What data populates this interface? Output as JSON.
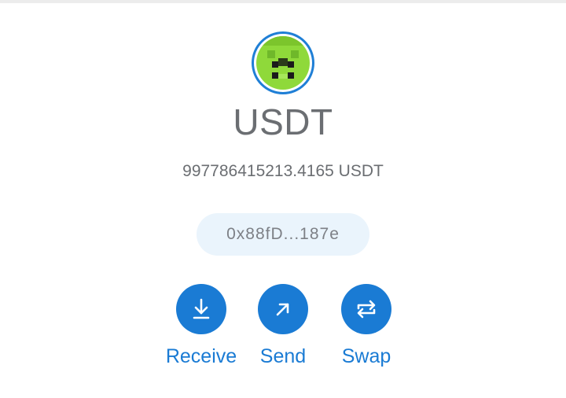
{
  "token": {
    "symbol": "USDT",
    "balance": "997786415213.4165 USDT",
    "address_short": "0x88fD...187e",
    "avatar_icon": "pixel-identicon"
  },
  "actions": [
    {
      "label": "Receive",
      "icon": "download-arrow-icon"
    },
    {
      "label": "Send",
      "icon": "arrow-up-right-icon"
    },
    {
      "label": "Swap",
      "icon": "swap-arrows-icon"
    }
  ],
  "colors": {
    "accent": "#1a7bd4",
    "pill_bg": "#eaf4fc",
    "text_muted": "#6b6e72",
    "avatar_green": "#8fd93a"
  }
}
